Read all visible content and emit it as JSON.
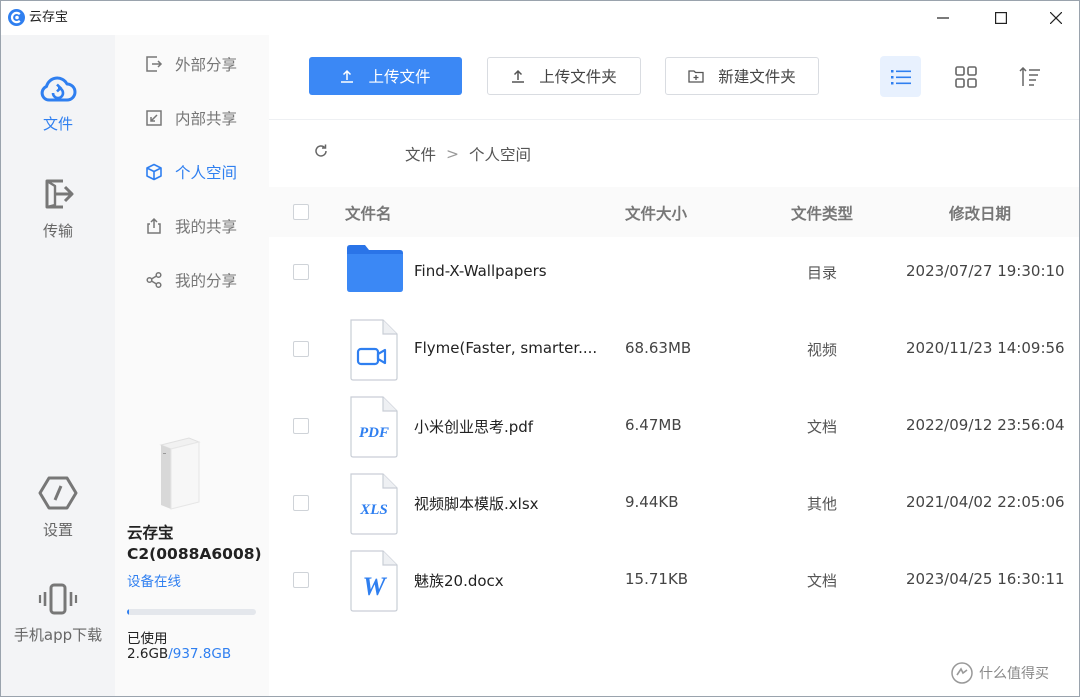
{
  "app": {
    "title": "云存宝"
  },
  "rail": {
    "items": [
      {
        "label": "文件"
      },
      {
        "label": "传输"
      },
      {
        "label": "设置"
      },
      {
        "label": "手机app下载"
      }
    ]
  },
  "subnav": {
    "items": [
      {
        "label": "外部分享"
      },
      {
        "label": "内部共享"
      },
      {
        "label": "个人空间"
      },
      {
        "label": "我的共享"
      },
      {
        "label": "我的分享"
      }
    ]
  },
  "device": {
    "name": "云存宝C2(0088A6008)",
    "status": "设备在线",
    "used_label": "已使用",
    "used": "2.6GB",
    "total": "/937.8GB",
    "used_fraction": 0.0028
  },
  "toolbar": {
    "upload_file": "上传文件",
    "upload_folder": "上传文件夹",
    "new_folder": "新建文件夹"
  },
  "breadcrumb": {
    "root": "文件",
    "separator": ">",
    "current": "个人空间"
  },
  "table": {
    "headers": {
      "name": "文件名",
      "size": "文件大小",
      "type": "文件类型",
      "modified": "修改日期"
    },
    "rows": [
      {
        "icon": "folder-icon",
        "name": "Find-X-Wallpapers",
        "size": "",
        "type": "目录",
        "modified": "2023/07/27 19:30:10"
      },
      {
        "icon": "video-file-icon",
        "name": "Flyme(Faster, smarter....",
        "size": "68.63MB",
        "type": "视频",
        "modified": "2020/11/23 14:09:56"
      },
      {
        "icon": "pdf-file-icon",
        "name": "小米创业思考.pdf",
        "size": "6.47MB",
        "type": "文档",
        "modified": "2022/09/12 23:56:04"
      },
      {
        "icon": "xls-file-icon",
        "name": "视频脚本模版.xlsx",
        "size": "9.44KB",
        "type": "其他",
        "modified": "2021/04/02 22:05:06"
      },
      {
        "icon": "word-file-icon",
        "name": "魅族20.docx",
        "size": "15.71KB",
        "type": "文档",
        "modified": "2023/04/25 16:30:11"
      }
    ]
  },
  "file_badges": {
    "pdf": "PDF",
    "xls": "XLS",
    "word": "W"
  },
  "watermark": {
    "text": "什么值得买"
  },
  "colors": {
    "accent": "#3b88f5",
    "folder": "#2f7ff0",
    "rail_bg": "#f3f4f6"
  }
}
